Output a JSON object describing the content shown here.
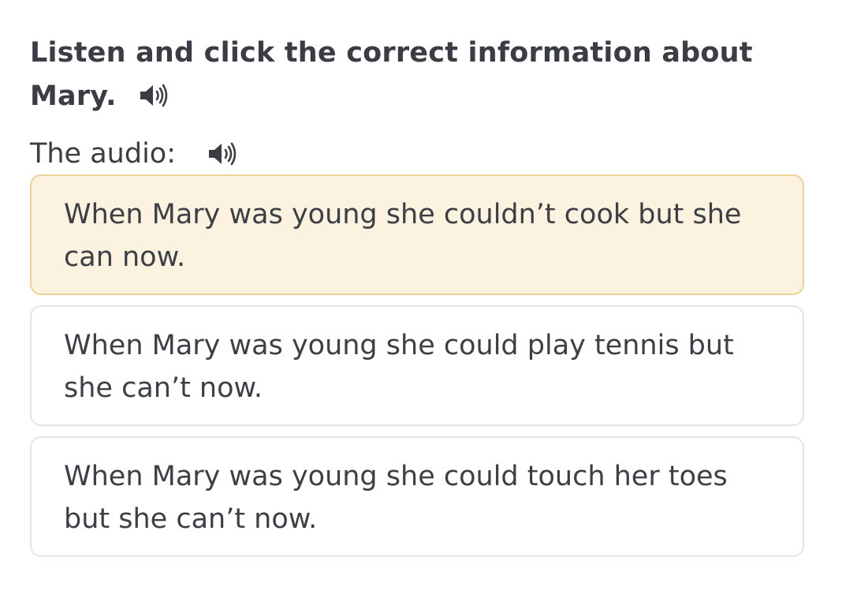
{
  "question": {
    "text": "Listen and click the correct information about Mary.",
    "speaker_icon": "speaker-icon"
  },
  "audio": {
    "label": "The audio:",
    "speaker_icon": "speaker-icon"
  },
  "options": [
    {
      "text": "When Mary was young she couldn’t cook but she can now.",
      "selected": true
    },
    {
      "text": "When Mary was young she could play tennis but she can’t now.",
      "selected": false
    },
    {
      "text": "When Mary was young she could touch her toes but she can’t now.",
      "selected": false
    }
  ],
  "colors": {
    "text": "#3c3f45",
    "selected_background": "#fbf2df",
    "selected_border": "#edd29a",
    "option_border": "#e3e5e8"
  }
}
